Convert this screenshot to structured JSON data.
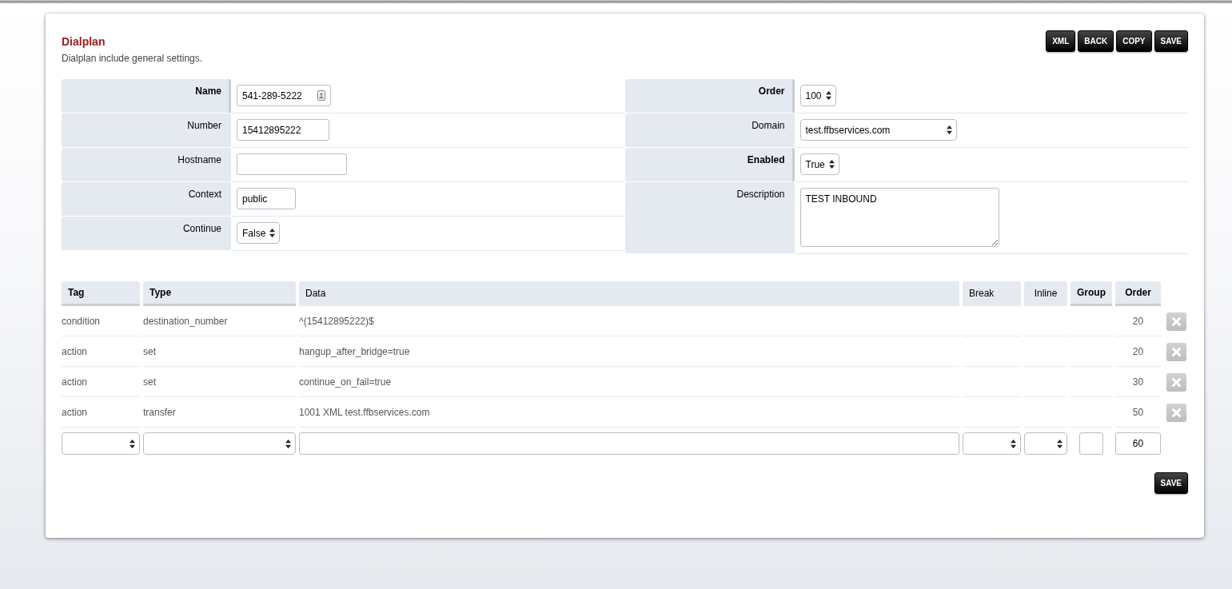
{
  "page": {
    "title": "Dialplan",
    "description": "Dialplan include general settings."
  },
  "toolbar": [
    "XML",
    "BACK",
    "COPY",
    "SAVE"
  ],
  "settings_left": [
    {
      "label": "Name",
      "required": true,
      "kind": "text",
      "value": "541-289-5222",
      "autofill": true
    },
    {
      "label": "Number",
      "required": false,
      "kind": "text",
      "value": "15412895222"
    },
    {
      "label": "Hostname",
      "required": false,
      "kind": "text"
    },
    {
      "label": "Context",
      "required": false,
      "kind": "text",
      "value": "public"
    },
    {
      "label": "Continue",
      "required": false,
      "kind": "select",
      "value": "False"
    }
  ],
  "settings_right": [
    {
      "label": "Order",
      "required": true,
      "kind": "select",
      "value": "100"
    },
    {
      "label": "Domain",
      "required": false,
      "kind": "select",
      "value": "test.ffbservices.com"
    },
    {
      "label": "Enabled",
      "required": true,
      "kind": "select",
      "value": "True"
    },
    {
      "label": "Description",
      "required": false,
      "kind": "textarea",
      "value": "TEST INBOUND"
    }
  ],
  "details": {
    "columns": [
      {
        "label": "Tag",
        "required": true,
        "kind": "select"
      },
      {
        "label": "Type",
        "required": true,
        "kind": "select"
      },
      {
        "label": "Data",
        "required": false,
        "kind": "text"
      },
      {
        "label": "Break",
        "required": false,
        "kind": "select"
      },
      {
        "label": "Inline",
        "required": false,
        "kind": "select"
      },
      {
        "label": "Group",
        "required": true,
        "kind": "text"
      },
      {
        "label": "Order",
        "required": true,
        "kind": "text"
      }
    ],
    "rows": [
      {
        "tag": "condition",
        "type": "destination_number",
        "data": "^(15412895222)$",
        "order": "20"
      },
      {
        "tag": "action",
        "type": "set",
        "data": "hangup_after_bridge=true",
        "order": "20"
      },
      {
        "tag": "action",
        "type": "set",
        "data": "continue_on_fail=true",
        "order": "30"
      },
      {
        "tag": "action",
        "type": "transfer",
        "data": "1001 XML test.ffbservices.com",
        "order": "50"
      }
    ],
    "new_row": {
      "order": "60"
    }
  },
  "footer_button": "SAVE"
}
